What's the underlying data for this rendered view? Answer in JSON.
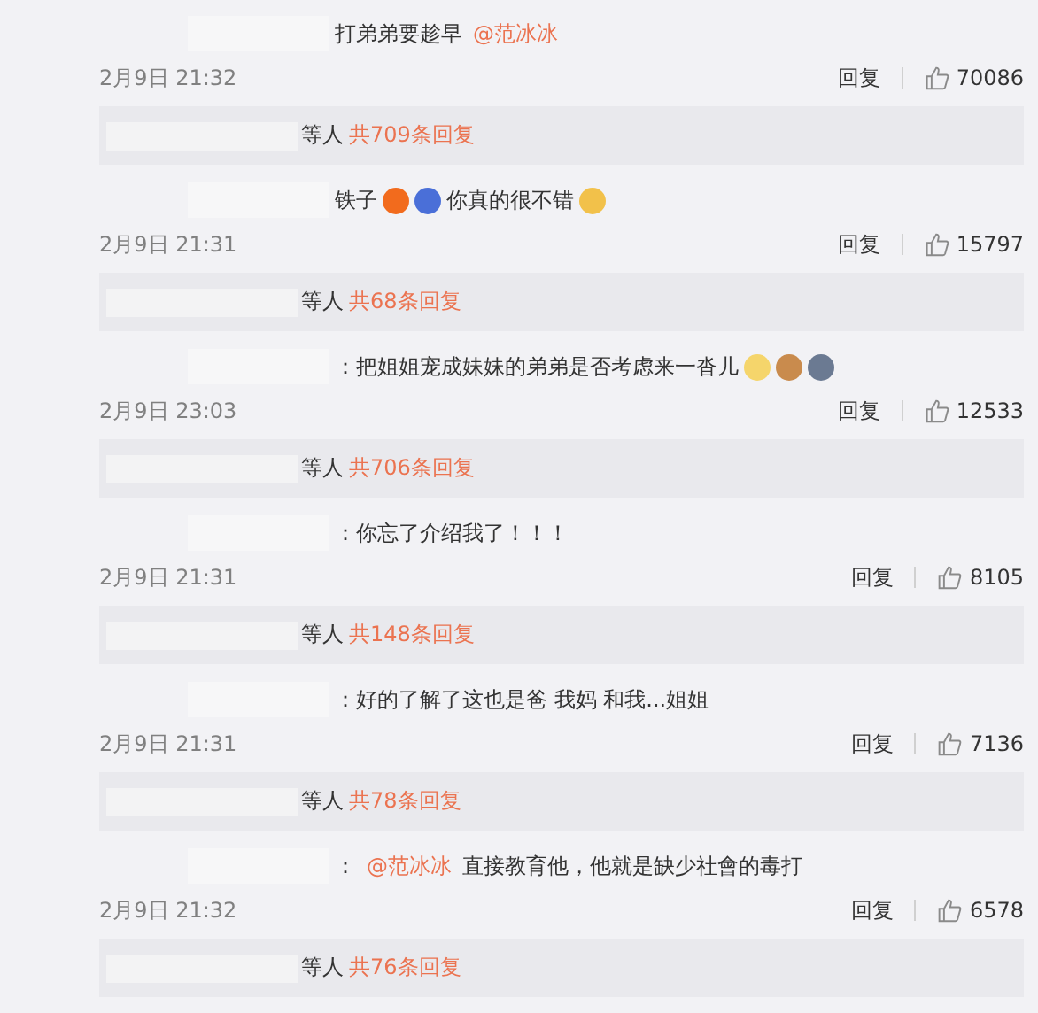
{
  "comments": [
    {
      "body": [
        {
          "kind": "text",
          "text": "打弟弟要趁早"
        },
        {
          "kind": "mention",
          "text": "@范冰冰"
        }
      ],
      "time": "2月9日 21:32",
      "reply_label": "回复",
      "likes": "70086",
      "replies": {
        "suffix": "等人",
        "count": "共709条回复"
      }
    },
    {
      "body": [
        {
          "kind": "text",
          "text": "铁子"
        },
        {
          "kind": "emoji",
          "color": "#f26b1d"
        },
        {
          "kind": "emoji",
          "color": "#4a6fd8"
        },
        {
          "kind": "text",
          "text": "你真的很不错"
        },
        {
          "kind": "emoji",
          "color": "#f2c14a"
        }
      ],
      "time": "2月9日 21:31",
      "reply_label": "回复",
      "likes": "15797",
      "replies": {
        "suffix": "等人",
        "count": "共68条回复"
      }
    },
    {
      "body": [
        {
          "kind": "text",
          "text": "：把姐姐宠成妹妹的弟弟是否考虑来一沓儿"
        },
        {
          "kind": "emoji",
          "color": "#f5d56b"
        },
        {
          "kind": "emoji",
          "color": "#c98b4d"
        },
        {
          "kind": "emoji",
          "color": "#6b7a92"
        }
      ],
      "time": "2月9日 23:03",
      "reply_label": "回复",
      "likes": "12533",
      "replies": {
        "suffix": "等人",
        "count": "共706条回复"
      }
    },
    {
      "body": [
        {
          "kind": "text",
          "text": "：你忘了介绍我了！！！"
        }
      ],
      "time": "2月9日 21:31",
      "reply_label": "回复",
      "likes": "8105",
      "replies": {
        "suffix": "等人",
        "count": "共148条回复"
      }
    },
    {
      "body": [
        {
          "kind": "text",
          "text": "：好的了解了这也是爸 我妈 和我...姐姐"
        }
      ],
      "time": "2月9日 21:31",
      "reply_label": "回复",
      "likes": "7136",
      "replies": {
        "suffix": "等人",
        "count": "共78条回复"
      }
    },
    {
      "body": [
        {
          "kind": "text",
          "text": "："
        },
        {
          "kind": "mention",
          "text": "@范冰冰"
        },
        {
          "kind": "text",
          "text": "直接教育他，他就是缺少社會的毒打"
        }
      ],
      "time": "2月9日 21:32",
      "reply_label": "回复",
      "likes": "6578",
      "replies": {
        "suffix": "等人",
        "count": "共76条回复"
      }
    }
  ]
}
